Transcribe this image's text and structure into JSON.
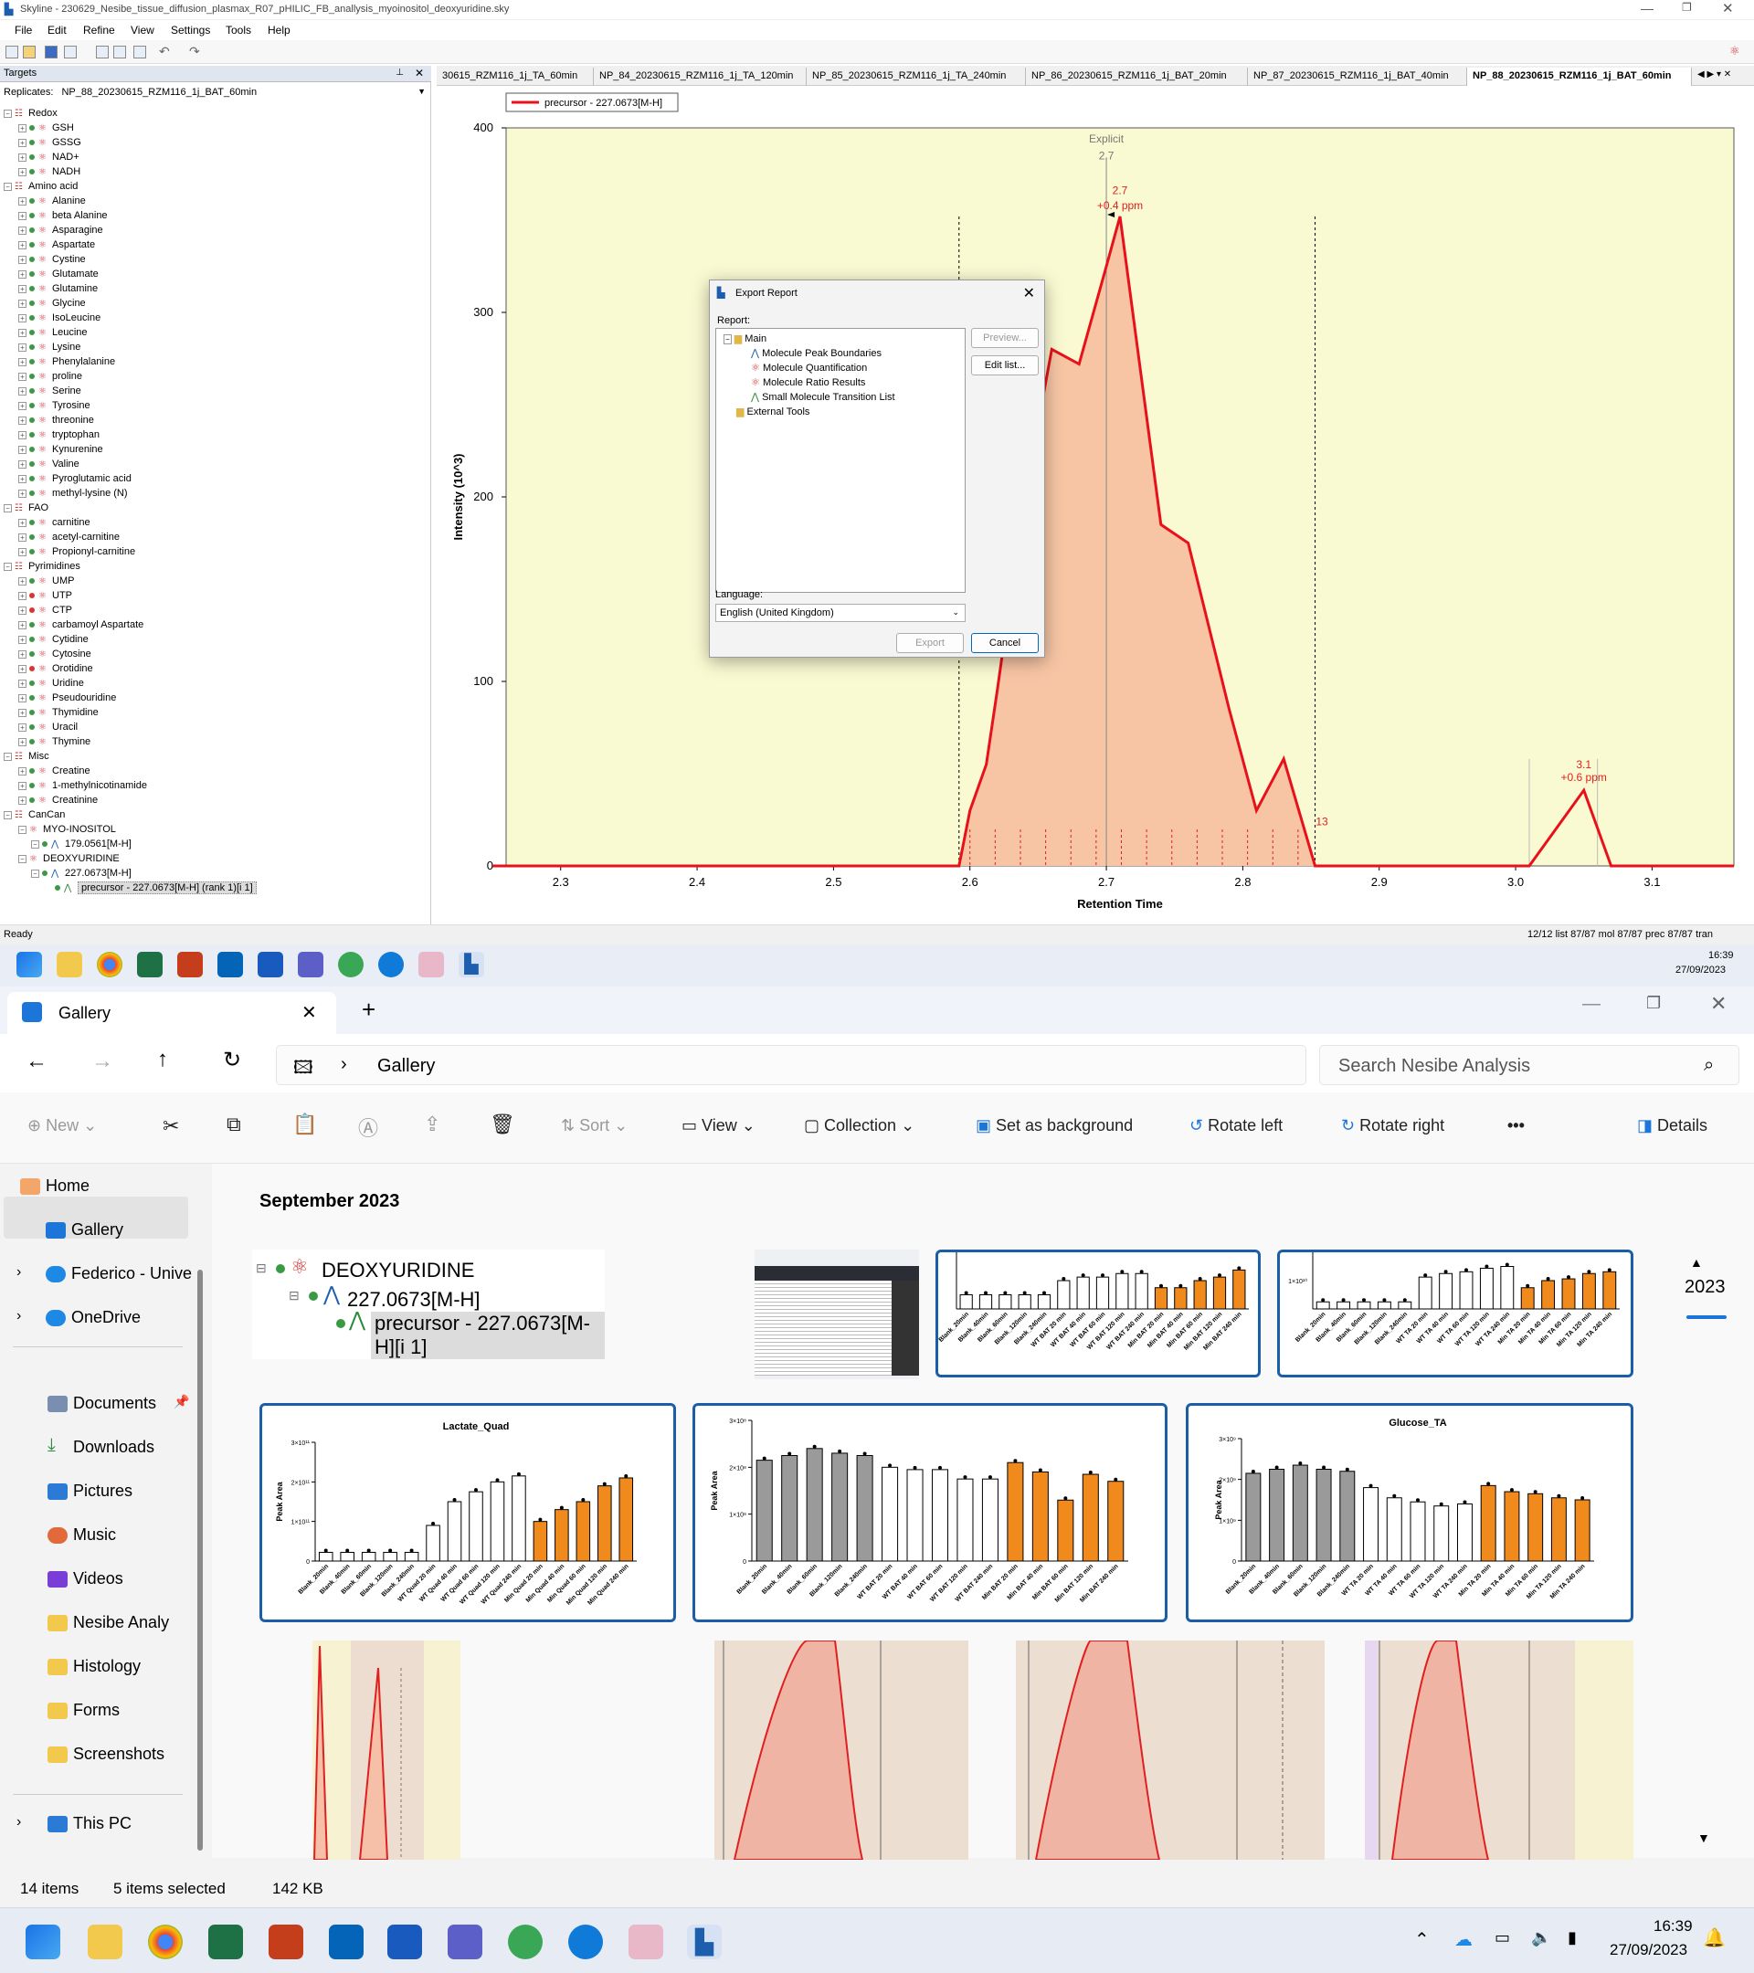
{
  "skyline": {
    "title": "Skyline - 230629_Nesibe_tissue_diffusion_plasmax_R07_pHILIC_FB_anallysis_myoinositol_deoxyuridine.sky",
    "menu": [
      "File",
      "Edit",
      "Refine",
      "View",
      "Settings",
      "Tools",
      "Help"
    ],
    "targets_label": "Targets",
    "replicates_label": "Replicates:",
    "replicate_value": "NP_88_20230615_RZM116_1j_BAT_60min",
    "tree": [
      {
        "group": "Redox",
        "items": [
          {
            "n": "GSH",
            "c": "green"
          },
          {
            "n": "GSSG",
            "c": "green"
          },
          {
            "n": "NAD+",
            "c": "green"
          },
          {
            "n": "NADH",
            "c": "green"
          }
        ]
      },
      {
        "group": "Amino acid",
        "items": [
          {
            "n": "Alanine",
            "c": "green"
          },
          {
            "n": "beta Alanine",
            "c": "green"
          },
          {
            "n": "Asparagine",
            "c": "green"
          },
          {
            "n": "Aspartate",
            "c": "green"
          },
          {
            "n": "Cystine",
            "c": "green"
          },
          {
            "n": "Glutamate",
            "c": "green"
          },
          {
            "n": "Glutamine",
            "c": "green"
          },
          {
            "n": "Glycine",
            "c": "green"
          },
          {
            "n": "IsoLeucine",
            "c": "green"
          },
          {
            "n": "Leucine",
            "c": "green"
          },
          {
            "n": "Lysine",
            "c": "green"
          },
          {
            "n": "Phenylalanine",
            "c": "green"
          },
          {
            "n": "proline",
            "c": "green"
          },
          {
            "n": "Serine",
            "c": "green"
          },
          {
            "n": "Tyrosine",
            "c": "green"
          },
          {
            "n": "threonine",
            "c": "green"
          },
          {
            "n": "tryptophan",
            "c": "green"
          },
          {
            "n": "Kynurenine",
            "c": "green"
          },
          {
            "n": "Valine",
            "c": "green"
          },
          {
            "n": "Pyroglutamic acid",
            "c": "green"
          },
          {
            "n": "methyl-lysine (N)",
            "c": "green"
          }
        ]
      },
      {
        "group": "FAO",
        "items": [
          {
            "n": "carnitine",
            "c": "green"
          },
          {
            "n": "acetyl-carnitine",
            "c": "green"
          },
          {
            "n": "Propionyl-carnitine",
            "c": "green"
          }
        ]
      },
      {
        "group": "Pyrimidines",
        "items": [
          {
            "n": "UMP",
            "c": "green"
          },
          {
            "n": "UTP",
            "c": "red"
          },
          {
            "n": "CTP",
            "c": "red"
          },
          {
            "n": "carbamoyl Aspartate",
            "c": "green"
          },
          {
            "n": "Cytidine",
            "c": "green"
          },
          {
            "n": "Cytosine",
            "c": "green"
          },
          {
            "n": "Orotidine",
            "c": "red"
          },
          {
            "n": "Uridine",
            "c": "green"
          },
          {
            "n": "Pseudouridine",
            "c": "green"
          },
          {
            "n": "Thymidine",
            "c": "green"
          },
          {
            "n": "Uracil",
            "c": "green"
          },
          {
            "n": "Thymine",
            "c": "green"
          }
        ]
      },
      {
        "group": "Misc",
        "items": [
          {
            "n": "Creatine",
            "c": "green"
          },
          {
            "n": "1-methylnicotinamide",
            "c": "green"
          },
          {
            "n": "Creatinine",
            "c": "green"
          }
        ]
      },
      {
        "group": "CanCan",
        "items": [
          {
            "n": "MYO-INOSITOL",
            "c": "none"
          },
          {
            "n": "179.0561[M-H]",
            "c": "green",
            "lvl": 2
          },
          {
            "n": "DEOXYURIDINE",
            "c": "none"
          },
          {
            "n": "227.0673[M-H]",
            "c": "green",
            "lvl": 2
          },
          {
            "n": "precursor - 227.0673[M-H] (rank 1)[i 1]",
            "c": "green",
            "lvl": 3
          }
        ]
      }
    ],
    "doc_tabs": [
      "30615_RZM116_1j_TA_60min",
      "NP_84_20230615_RZM116_1j_TA_120min",
      "NP_85_20230615_RZM116_1j_TA_240min",
      "NP_86_20230615_RZM116_1j_BAT_20min",
      "NP_87_20230615_RZM116_1j_BAT_40min",
      "NP_88_20230615_RZM116_1j_BAT_60min"
    ],
    "status_left": "Ready",
    "status_right": "12/12 list   87/87 mol   87/87 prec   87/87 tran",
    "clock_time": "16:39",
    "clock_date": "27/09/2023"
  },
  "chart_data": {
    "type": "area",
    "legend": "precursor - 227.0673[M-H]",
    "xlabel": "Retention Time",
    "ylabel": "Intensity (10^3)",
    "xlim": [
      2.26,
      3.16
    ],
    "ylim": [
      0,
      400
    ],
    "x_ticks": [
      2.3,
      2.4,
      2.5,
      2.6,
      2.7,
      2.8,
      2.9,
      3.0,
      3.1
    ],
    "y_ticks": [
      0,
      100,
      200,
      300,
      400
    ],
    "series": [
      {
        "x": [
          2.25,
          2.592,
          2.6,
          2.612,
          2.62,
          2.64,
          2.66,
          2.68,
          2.7,
          2.71,
          2.74,
          2.76,
          2.79,
          2.81,
          2.83,
          2.853,
          3.01,
          3.05,
          3.07,
          3.16
        ],
        "y": [
          0,
          0,
          30,
          55,
          95,
          200,
          280,
          272,
          325,
          352,
          185,
          175,
          85,
          30,
          58,
          0,
          0,
          41,
          0,
          0
        ]
      }
    ],
    "annotations": [
      {
        "text": "Explicit",
        "x": 2.7,
        "y": 392
      },
      {
        "text": "2.7",
        "x": 2.7,
        "y": 383
      },
      {
        "text": "2.7",
        "x": 2.71,
        "y": 364
      },
      {
        "text": "+0.4 ppm",
        "x": 2.71,
        "y": 356
      },
      {
        "text": "3.1",
        "x": 3.05,
        "y": 53
      },
      {
        "text": "+0.6 ppm",
        "x": 3.05,
        "y": 46
      },
      {
        "text": "13",
        "x": 2.858,
        "y": 22
      }
    ],
    "boundaries": [
      2.592,
      2.853
    ]
  },
  "dialog": {
    "title": "Export Report",
    "report_label": "Report:",
    "folder_main": "Main",
    "items": [
      "Molecule Peak Boundaries",
      "Molecule Quantification",
      "Molecule Ratio Results",
      "Small Molecule Transition List"
    ],
    "folder_ext": "External Tools",
    "preview": "Preview...",
    "edit_list": "Edit list...",
    "language_label": "Language:",
    "language_value": "English (United Kingdom)",
    "export": "Export",
    "cancel": "Cancel"
  },
  "gallery": {
    "tab_title": "Gallery",
    "crumb": "Gallery",
    "search_placeholder": "Search Nesibe Analysis",
    "commands": {
      "new": "New",
      "sort": "Sort",
      "view": "View",
      "collection": "Collection",
      "set_bg": "Set as background",
      "rotate_left": "Rotate left",
      "rotate_right": "Rotate right",
      "details": "Details"
    },
    "nav": {
      "home": "Home",
      "gallery": "Gallery",
      "federico": "Federico - Unive",
      "onedrive": "OneDrive",
      "documents": "Documents",
      "downloads": "Downloads",
      "pictures": "Pictures",
      "music": "Music",
      "videos": "Videos",
      "nesibe": "Nesibe Analy",
      "histology": "Histology",
      "forms": "Forms",
      "screenshots": "Screenshots",
      "thispc": "This PC"
    },
    "section": "September 2023",
    "year": "2023",
    "status_count": "14 items",
    "status_sel": "5 items selected",
    "status_size": "142 KB",
    "thumb_tree": [
      "DEOXYURIDINE",
      "227.0673[M-H]",
      "precursor - 227.0673[M-H][i 1]"
    ],
    "chart_titles": [
      "Lactate_Quad",
      "",
      "Glucose_TA"
    ],
    "chart_ylabel": "Peak Area",
    "lactate_ticks": [
      "3×10¹¹",
      "2×10¹¹",
      "1×10¹¹",
      "0"
    ],
    "mid_ticks": [
      "3×10⁸",
      "2×10⁸",
      "1×10⁸",
      "0"
    ],
    "glucose_ticks": [
      "3×10⁹",
      "2×10⁹",
      "1×10⁹",
      "0"
    ],
    "lactate_cats": [
      "Blank_20min",
      "Blank_40min",
      "Blank_60min",
      "Blank_120min",
      "Blank_240min",
      "WT Quad 20 min",
      "WT Quad 40 min",
      "WT Quad 60 min",
      "WT Quad 120 min",
      "WT Quad 240 min",
      "Min Quad 20 min",
      "Min Quad 40 min",
      "Min Quad 60 min",
      "Min Quad 120 min",
      "Min Quad 240 min"
    ],
    "bat_cats": [
      "Blank_20min",
      "Blank_40min",
      "Blank_60min",
      "Blank_120min",
      "Blank_240min",
      "WT BAT 20 min",
      "WT BAT 40 min",
      "WT BAT 60 min",
      "WT BAT 120 min",
      "WT BAT 240 min",
      "Min BAT 20 min",
      "Min BAT 40 min",
      "Min BAT 60 min",
      "Min BAT 120 min",
      "Min BAT 240 min"
    ],
    "ta_cats": [
      "Blank_20min",
      "Blank_40min",
      "Blank_60min",
      "Blank_120min",
      "Blank_240min",
      "WT TA 20 min",
      "WT TA 40 min",
      "WT TA 60 min",
      "WT TA 120 min",
      "WT TA 240 min",
      "Min TA 20 min",
      "Min TA 40 min",
      "Min TA 60 min",
      "Min TA 120 min",
      "Min TA 240 min"
    ],
    "lactate_vals": [
      0.22,
      0.22,
      0.22,
      0.22,
      0.22,
      0.9,
      1.5,
      1.75,
      2.0,
      2.15,
      1.0,
      1.3,
      1.5,
      1.9,
      2.1
    ],
    "mid_vals": [
      2.15,
      2.25,
      2.4,
      2.3,
      2.25,
      2.0,
      1.95,
      1.95,
      1.75,
      1.75,
      2.1,
      1.9,
      1.3,
      1.85,
      1.7
    ],
    "glucose_vals": [
      2.15,
      2.25,
      2.35,
      2.25,
      2.2,
      1.8,
      1.55,
      1.45,
      1.35,
      1.4,
      1.85,
      1.7,
      1.65,
      1.55,
      1.5
    ],
    "top1_vals": [
      0.2,
      0.2,
      0.2,
      0.2,
      0.2,
      0.4,
      0.45,
      0.45,
      0.5,
      0.5,
      0.3,
      0.3,
      0.4,
      0.45,
      0.55
    ],
    "top2_vals": [
      0.2,
      0.2,
      0.2,
      0.2,
      0.2,
      0.9,
      1.0,
      1.05,
      1.15,
      1.2,
      0.6,
      0.8,
      0.85,
      1.0,
      1.05
    ],
    "top_tick": "1×10¹⁰"
  },
  "taskbar": {
    "time": "16:39",
    "date": "27/09/2023"
  }
}
